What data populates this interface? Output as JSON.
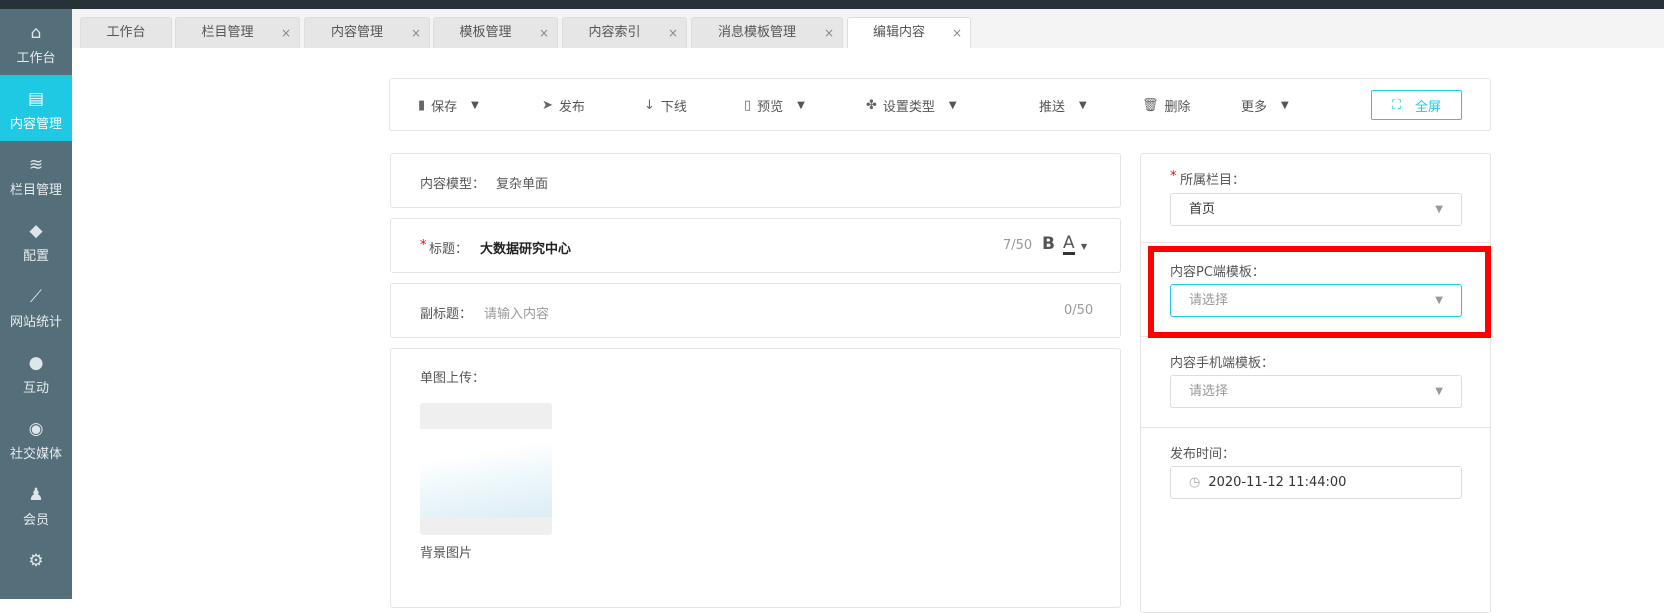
{
  "sidebar": {
    "items": [
      {
        "label": "工作台",
        "icon": "home-icon"
      },
      {
        "label": "内容管理",
        "icon": "document-icon",
        "active": true
      },
      {
        "label": "栏目管理",
        "icon": "layers-icon"
      },
      {
        "label": "配置",
        "icon": "cube-icon"
      },
      {
        "label": "网站统计",
        "icon": "line-chart-icon"
      },
      {
        "label": "互动",
        "icon": "chat-icon"
      },
      {
        "label": "社交媒体",
        "icon": "target-icon"
      },
      {
        "label": "会员",
        "icon": "member-icon"
      },
      {
        "label": "",
        "icon": "gear-icon"
      }
    ]
  },
  "tabs": [
    {
      "label": "工作台"
    },
    {
      "label": "栏目管理"
    },
    {
      "label": "内容管理"
    },
    {
      "label": "模板管理"
    },
    {
      "label": "内容索引"
    },
    {
      "label": "消息模板管理"
    },
    {
      "label": "编辑内容",
      "active": true
    }
  ],
  "toolbar": {
    "save": "保存",
    "publish": "发布",
    "offline": "下线",
    "preview": "预览",
    "set_type": "设置类型",
    "push": "推送",
    "delete": "删除",
    "more": "更多",
    "fullscreen": "全屏"
  },
  "form": {
    "model_label": "内容模型：",
    "model_value": "复杂单面",
    "title_label": "标题：",
    "title_value": "大数据研究中心",
    "title_count": "7/50",
    "subtitle_label": "副标题：",
    "subtitle_placeholder": "请输入内容",
    "subtitle_count": "0/50",
    "image_label": "单图上传：",
    "image_caption": "背景图片"
  },
  "side": {
    "column_label": "所属栏目：",
    "column_value": "首页",
    "pc_label": "内容PC端模板：",
    "pc_placeholder": "请选择",
    "mobile_label": "内容手机端模板：",
    "mobile_placeholder": "请选择",
    "time_label": "发布时间：",
    "time_value": "2020-11-12 11:44:00"
  },
  "colors": {
    "accent": "#1fc8e3",
    "sidebar": "#546e7a",
    "highlight": "#ff0000"
  }
}
